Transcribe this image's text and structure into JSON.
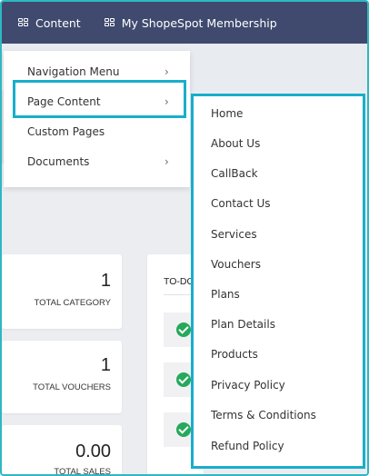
{
  "topbar": {
    "nav": [
      {
        "label": "Content",
        "icon": "grid-icon"
      },
      {
        "label": "My ShopeSpot Membership",
        "icon": "grid-icon"
      }
    ]
  },
  "dropdown": {
    "items": [
      {
        "label": "Navigation Menu",
        "has_submenu": true
      },
      {
        "label": "Page Content",
        "has_submenu": true,
        "active": true
      },
      {
        "label": "Custom Pages",
        "has_submenu": false
      },
      {
        "label": "Documents",
        "has_submenu": true
      }
    ],
    "chevron": "›"
  },
  "submenu": {
    "items": [
      "Home",
      "About Us",
      "CallBack",
      "Contact Us",
      "Services",
      "Vouchers",
      "Plans",
      "Plan Details",
      "Products",
      "Privacy Policy",
      "Terms & Conditions",
      "Refund Policy"
    ]
  },
  "dashboard": {
    "stats": [
      {
        "value": "1",
        "label": "TOTAL CATEGORY"
      },
      {
        "value": "1",
        "label": "TOTAL VOUCHERS"
      },
      {
        "value": "0.00",
        "label": "TOTAL SALES"
      }
    ],
    "todo_title": "TO-DO"
  },
  "colors": {
    "topbar": "#3f4a6e",
    "highlight": "#18aecb",
    "check": "#27a85a"
  }
}
